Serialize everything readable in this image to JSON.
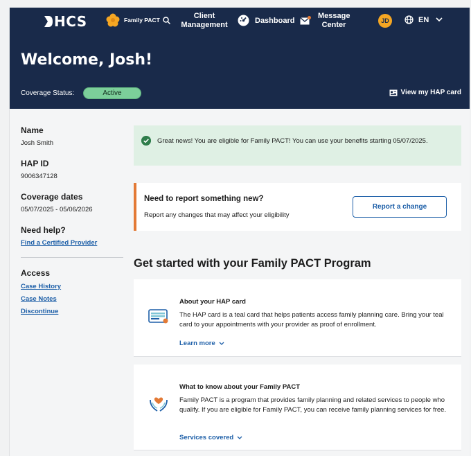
{
  "nav": {
    "logo": "HCS",
    "program": "Family PACT",
    "client_management": "Client Management",
    "dashboard": "Dashboard",
    "message_center": "Message Center",
    "avatar_initials": "JD",
    "language": "EN"
  },
  "hero": {
    "welcome": "Welcome, Josh!",
    "coverage_label": "Coverage Status:",
    "coverage_status": "Active",
    "hap_card_link": "View my HAP card"
  },
  "sidebar": {
    "name_label": "Name",
    "name_value": "Josh Smith",
    "hap_id_label": "HAP ID",
    "hap_id_value": "9006347128",
    "coverage_dates_label": "Coverage dates",
    "coverage_dates_value": "05/07/2025 - 05/06/2026",
    "help_label": "Need help?",
    "help_link": "Find a Certified Provider",
    "access_label": "Access",
    "access_links": [
      "Case History",
      "Case Notes",
      "Discontinue"
    ]
  },
  "alert": {
    "message": "Great news! You are eligible for Family PACT! You can use your benefits starting 05/07/2025."
  },
  "report": {
    "heading": "Need to report something new?",
    "subtext": "Report any changes that may affect your eligibility",
    "button": "Report a change"
  },
  "section_title": "Get started with your Family PACT Program",
  "cards": [
    {
      "title": "About your HAP card",
      "body": "The HAP card is a teal card that helps patients access family planning care. Bring your teal card to your appointments with your provider as proof of enrollment.",
      "link": "Learn more"
    },
    {
      "title": "What to know about your Family PACT",
      "body": "Family PACT is a program that provides family planning and related services to people who qualify. If you are eligible for Family PACT, you can receive family planning services for free.",
      "link": "Services covered"
    }
  ],
  "colors": {
    "navy": "#192a4a",
    "active_badge": "#7ccf9a",
    "success_bg": "#dff0e4",
    "accent_orange": "#e37a36",
    "link_blue": "#1d5fa8"
  }
}
